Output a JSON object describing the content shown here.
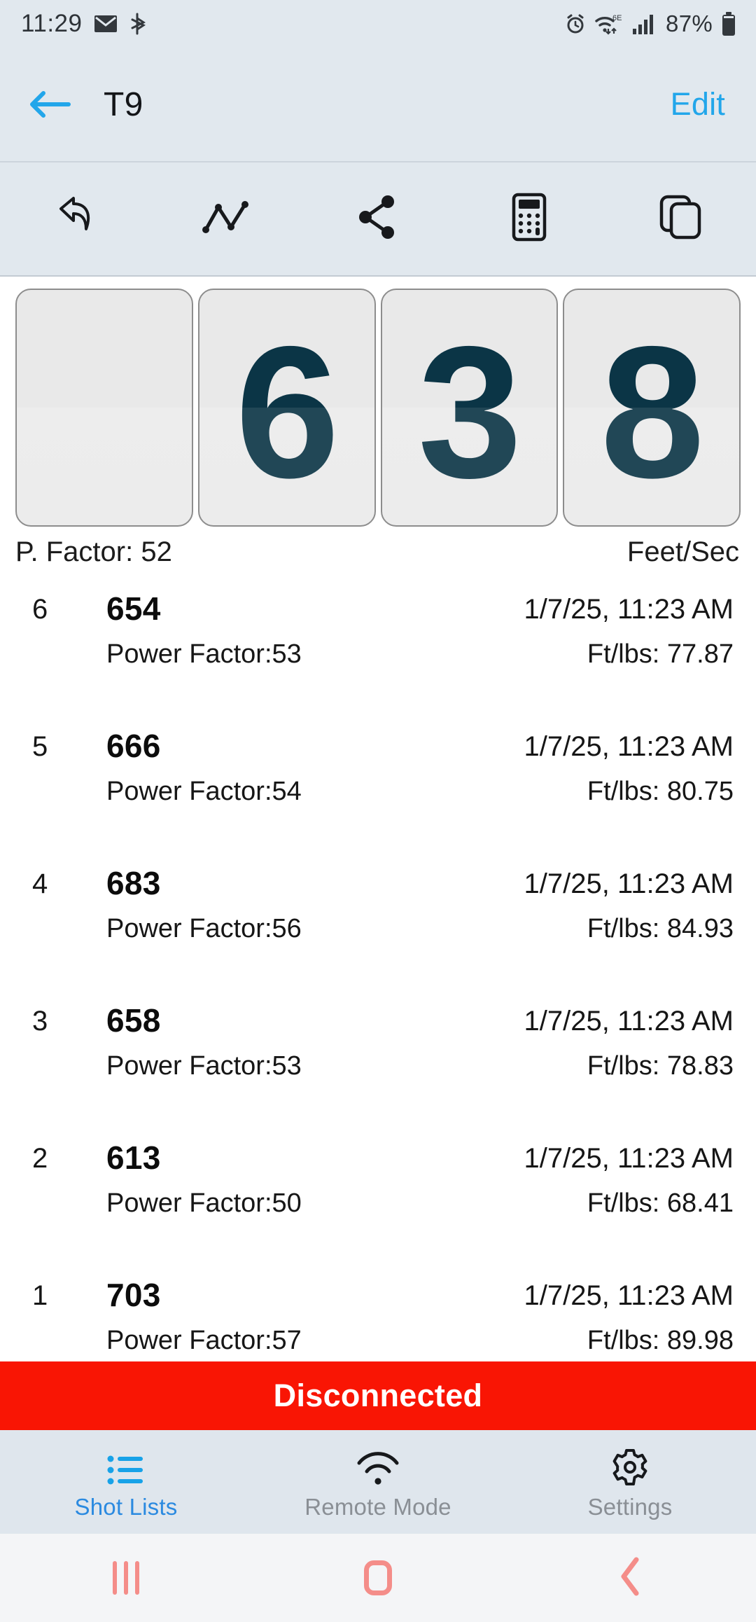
{
  "status_bar": {
    "time": "11:29",
    "battery_percent": "87%",
    "icons": [
      "email-icon",
      "bluetooth-share-icon",
      "alarm-icon",
      "wifi-6e-icon",
      "cellular-signal-icon",
      "battery-icon"
    ],
    "wifi_label": "6E"
  },
  "nav": {
    "back_icon": "back-arrow-icon",
    "title": "T9",
    "edit_label": "Edit",
    "accent_color": "#22a6ea"
  },
  "toolbar": {
    "items": [
      {
        "name": "undo-icon",
        "label": "Undo"
      },
      {
        "name": "line-chart-icon",
        "label": "Chart"
      },
      {
        "name": "share-icon",
        "label": "Share"
      },
      {
        "name": "calculator-icon",
        "label": "Calculator"
      },
      {
        "name": "copy-icon",
        "label": "Copy"
      }
    ]
  },
  "reel": {
    "digits": [
      "",
      "6",
      "3",
      "8"
    ],
    "value": "638",
    "digit_color": "#0b3546"
  },
  "sub_labels": {
    "power_factor": "P. Factor: 52",
    "units": "Feet/Sec"
  },
  "shot_list": {
    "rows": [
      {
        "index": "6",
        "value": "654",
        "power_factor": "Power Factor:53",
        "timestamp": "1/7/25, 11:23 AM",
        "ftlbs": "Ft/lbs: 77.87"
      },
      {
        "index": "5",
        "value": "666",
        "power_factor": "Power Factor:54",
        "timestamp": "1/7/25, 11:23 AM",
        "ftlbs": "Ft/lbs: 80.75"
      },
      {
        "index": "4",
        "value": "683",
        "power_factor": "Power Factor:56",
        "timestamp": "1/7/25, 11:23 AM",
        "ftlbs": "Ft/lbs: 84.93"
      },
      {
        "index": "3",
        "value": "658",
        "power_factor": "Power Factor:53",
        "timestamp": "1/7/25, 11:23 AM",
        "ftlbs": "Ft/lbs: 78.83"
      },
      {
        "index": "2",
        "value": "613",
        "power_factor": "Power Factor:50",
        "timestamp": "1/7/25, 11:23 AM",
        "ftlbs": "Ft/lbs: 68.41"
      },
      {
        "index": "1",
        "value": "703",
        "power_factor": "Power Factor:57",
        "timestamp": "1/7/25, 11:23 AM",
        "ftlbs": "Ft/lbs: 89.98"
      }
    ]
  },
  "banner": {
    "text": "Disconnected",
    "background_color": "#f91504",
    "text_color": "#ffffff"
  },
  "tab_bar": {
    "tabs": [
      {
        "label": "Shot Lists",
        "icon": "list-icon",
        "active": true
      },
      {
        "label": "Remote Mode",
        "icon": "wifi-icon",
        "active": false
      },
      {
        "label": "Settings",
        "icon": "gear-icon",
        "active": false
      }
    ],
    "active_color": "#2b8ae0",
    "inactive_color": "#8a8f95"
  },
  "android_nav": {
    "recents_icon": "recents-icon",
    "home_icon": "home-icon",
    "back_icon": "back-icon",
    "color": "#f48d89"
  }
}
